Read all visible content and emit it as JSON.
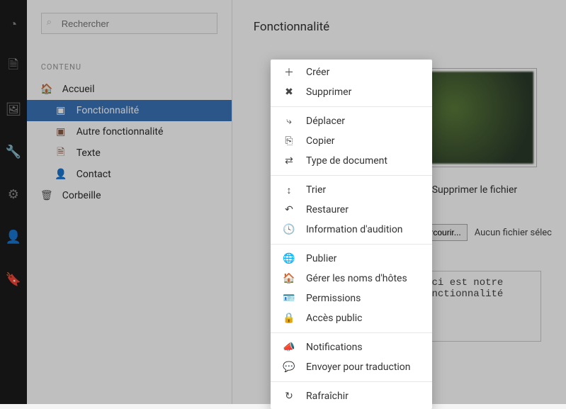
{
  "search": {
    "placeholder": "Rechercher"
  },
  "section_label": "CONTENU",
  "tree": {
    "home": "Accueil",
    "feature": "Fonctionnalité",
    "other_feature": "Autre fonctionnalité",
    "text": "Texte",
    "contact": "Contact",
    "trash": "Corbeille"
  },
  "main": {
    "title": "Fonctionnalité",
    "delete_file_label": "Supprimer le fichier",
    "browse_label": "Parcourir...",
    "file_status": "Aucun fichier sélec",
    "textarea_value": "Ceci est notre fonctionnalité"
  },
  "menu": {
    "create": "Créer",
    "delete": "Supprimer",
    "move": "Déplacer",
    "copy": "Copier",
    "doctype": "Type de document",
    "sort": "Trier",
    "restore": "Restaurer",
    "audit": "Information d'audition",
    "publish": "Publier",
    "hosts": "Gérer les noms d'hôtes",
    "permissions": "Permissions",
    "public": "Accès public",
    "notifications": "Notifications",
    "translate": "Envoyer pour traduction",
    "refresh": "Rafraîchir"
  }
}
